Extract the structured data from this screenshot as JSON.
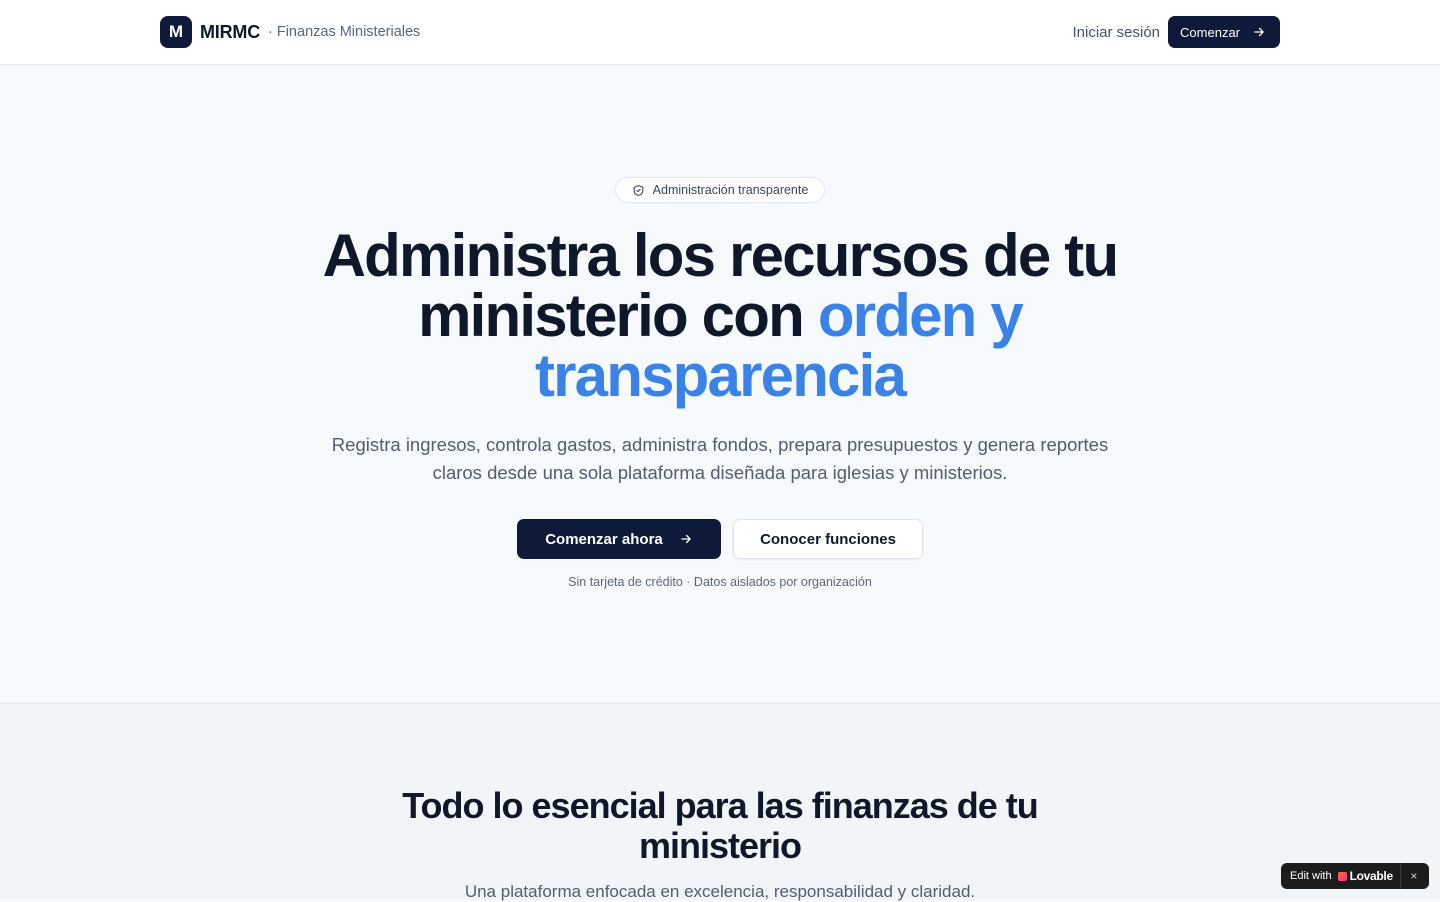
{
  "header": {
    "logo_letter": "M",
    "brand_name": "MIRMC",
    "brand_subtitle": "· Finanzas Ministeriales",
    "login_label": "Iniciar sesión",
    "start_label": "Comenzar"
  },
  "hero": {
    "badge_label": "Administración transparente",
    "title_main": "Administra los recursos de tu ministerio con",
    "title_accent": "orden y transparencia",
    "subtitle": "Registra ingresos, controla gastos, administra fondos, prepara presupuestos y genera reportes claros desde una sola plataforma diseñada para iglesias y ministerios.",
    "primary_cta": "Comenzar ahora",
    "secondary_cta": "Conocer funciones",
    "fineprint": "Sin tarjeta de crédito · Datos aislados por organización"
  },
  "features": {
    "title": "Todo lo esencial para las finanzas de tu ministerio",
    "subtitle": "Una plataforma enfocada en excelencia, responsabilidad y claridad."
  },
  "lovable_badge": {
    "edit_label": "Edit with",
    "brand": "Lovable",
    "close_symbol": "×"
  },
  "colors": {
    "primary": "#0f1a3b",
    "accent": "#3b82e6",
    "background": "#f7fafd"
  },
  "icons": {
    "badge_icon": "shield-check-icon",
    "arrow": "arrow-right-icon"
  }
}
